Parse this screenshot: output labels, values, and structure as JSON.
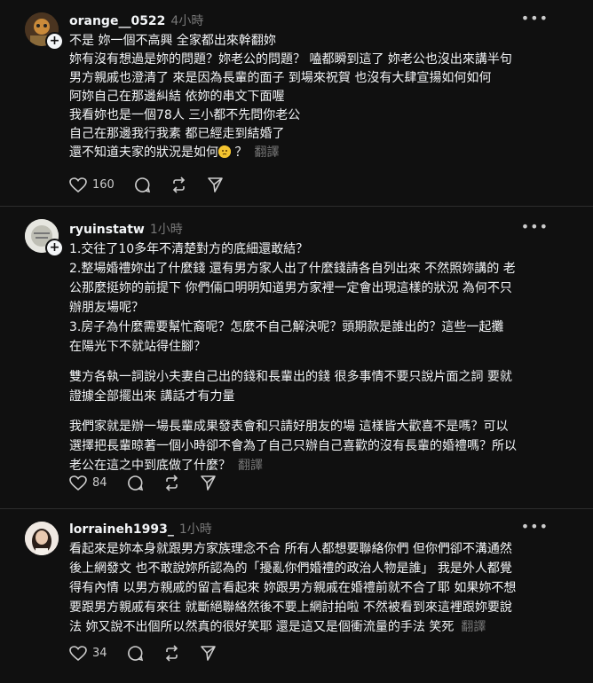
{
  "posts": [
    {
      "username": "orange__0522",
      "time": "4小時",
      "lines": [
        "不是 妳一個不高興 全家都出來幹翻妳",
        "妳有沒有想過是妳的問題？妳老公的問題？ 嗑都瞬到這了 妳老公也沒出來講半句",
        "男方親戚也澄清了 來是因為長輩的面子 到場來祝賀 也沒有大肆宣揚如何如何",
        "阿妳自己在那邊糾結 依妳的串文下面喔",
        "我看妳也是一個78人 三小都不先問你老公",
        "自己在那邊我行我素 都已經走到結婚了"
      ],
      "last_line": "還不知道夫家的狀況是如何",
      "last_suffix": "？",
      "translate": "翻譯",
      "likes": "160"
    },
    {
      "username": "ryuinstatw",
      "time": "1小時",
      "paragraphs": [
        [
          "1.交往了10多年不清楚對方的底細還敢結？",
          "2.整場婚禮妳出了什麼錢 還有男方家人出了什麼錢請各自列出來 不然照妳講的 老",
          "公那麼挺妳的前提下 你們倆口明明知道男方家裡一定會出現這樣的狀況 為何不只",
          "辦朋友場呢？",
          "3.房子為什麼需要幫忙裔呢？怎麼不自己解決呢？頭期款是誰出的？這些一起攤",
          "在陽光下不就站得住腳？"
        ],
        [
          "雙方各執一詞說小夫妻自己出的錢和長輩出的錢 很多事情不要只說片面之詞 要就",
          "證據全部擺出來 講話才有力量"
        ],
        [
          "我們家就是辦一場長輩成果發表會和只請好朋友的場 這樣皆大歡喜不是嗎？可以",
          "選擇把長輩晾著一個小時卻不會為了自己只辦自己喜歡的沒有長輩的婚禮嗎？所以",
          "老公在這之中到底做了什麼？"
        ]
      ],
      "translate": "翻譯",
      "likes": "84"
    },
    {
      "username": "lorraineh1993_",
      "time": "1小時",
      "lines": [
        "看起來是妳本身就跟男方家族理念不合 所有人都想要聯絡你們 但你們卻不溝通然",
        "後上網發文 也不敢說妳所認為的「擾亂你們婚禮的政治人物是誰」 我是外人都覺",
        "得有內情 以男方親戚的留言看起來 妳跟男方親戚在婚禮前就不合了耶 如果妳不想",
        "要跟男方親戚有來往 就斷絕聯絡然後不要上網討拍啦 不然被看到來這裡跟妳要說"
      ],
      "last_line": "法 妳又說不出個所以然真的很好笑耶 還是這又是個衝流量的手法 笑死",
      "translate": "翻譯",
      "likes": "34"
    }
  ]
}
